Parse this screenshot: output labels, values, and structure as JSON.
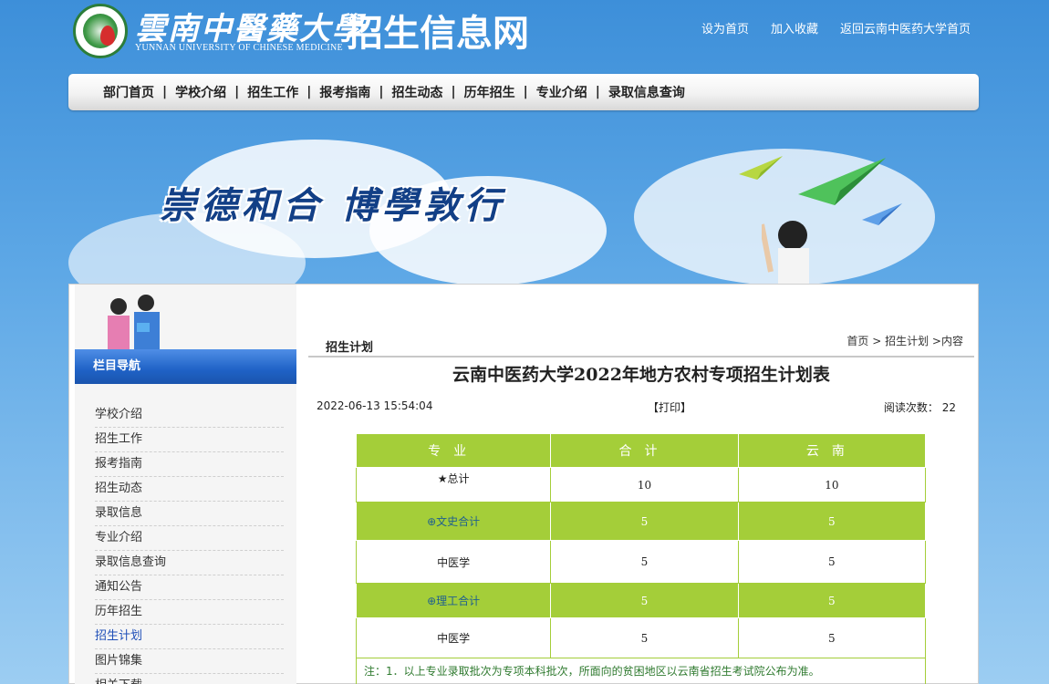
{
  "header": {
    "logo_cn": "雲南中醫藥大學",
    "logo_en": "YUNNAN UNIVERSITY OF CHINESE MEDICINE",
    "site_title": "招生信息网",
    "top_links": [
      "设为首页",
      "加入收藏",
      "返回云南中医药大学首页"
    ]
  },
  "nav": [
    "部门首页",
    "学校介绍",
    "招生工作",
    "报考指南",
    "招生动态",
    "历年招生",
    "专业介绍",
    "录取信息查询"
  ],
  "banner": {
    "slogan": "崇德和合  博學敦行"
  },
  "sidebar": {
    "heading": "栏目导航",
    "items": [
      "学校介绍",
      "招生工作",
      "报考指南",
      "招生动态",
      "录取信息",
      "专业介绍",
      "录取信息查询",
      "通知公告",
      "历年招生",
      "招生计划",
      "图片锦集",
      "相关下载"
    ],
    "active_item": "招生计划"
  },
  "main": {
    "section_title": "招生计划",
    "breadcrumb": [
      "首页",
      "招生计划",
      "内容"
    ],
    "article_title": "云南中医药大学2022年地方农村专项招生计划表",
    "date": "2022-06-13 15:54:04",
    "print_label": "【打印】",
    "views_label": "阅读次数：",
    "views_count": "22"
  },
  "table": {
    "headers": [
      "专业",
      "合计",
      "云南"
    ],
    "rows": [
      {
        "name": "★总计",
        "total": "10",
        "yunnan": "10",
        "type": "total"
      },
      {
        "name": "⊕文史合计",
        "total": "5",
        "yunnan": "5",
        "type": "sub"
      },
      {
        "name": "中医学",
        "total": "5",
        "yunnan": "5",
        "type": "row"
      },
      {
        "name": "⊕理工合计",
        "total": "5",
        "yunnan": "5",
        "type": "sub"
      },
      {
        "name": "中医学",
        "total": "5",
        "yunnan": "5",
        "type": "row"
      }
    ],
    "note": "注：1．以上专业录取批次为专项本科批次，所面向的贫困地区以云南省招生考试院公布为准。"
  },
  "colors": {
    "table_green": "#a4ce39",
    "nav_blue": "#1f62c6",
    "sky": "#5ea8e6"
  }
}
